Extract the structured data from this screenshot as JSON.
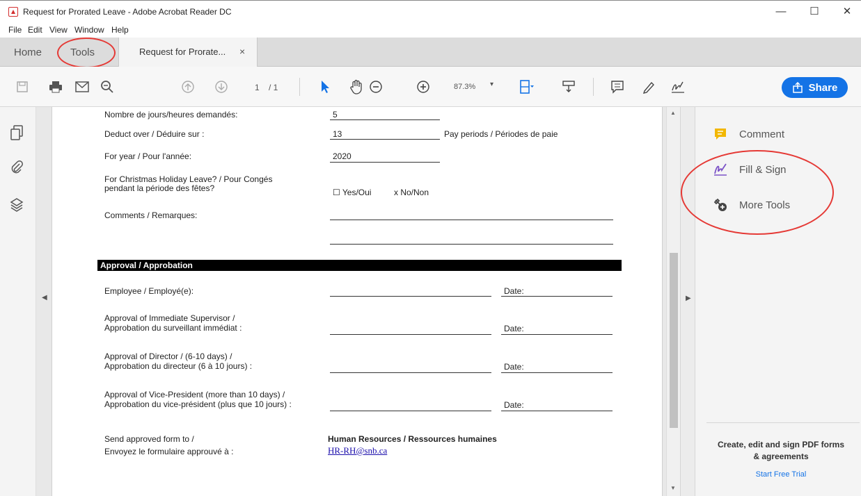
{
  "window": {
    "title": "Request for Prorated Leave - Adobe Acrobat Reader DC",
    "minimize": "—",
    "maximize": "☐",
    "close": "✕"
  },
  "menu": {
    "items": [
      "File",
      "Edit",
      "View",
      "Window",
      "Help"
    ]
  },
  "tabs": {
    "home": "Home",
    "tools": "Tools",
    "document": "Request for Prorate...",
    "close": "×"
  },
  "toolbar": {
    "page_current": "1",
    "page_total": "/ 1",
    "zoom": "87.3%",
    "share_label": "Share"
  },
  "right_panel": {
    "comment": "Comment",
    "fill_sign": "Fill & Sign",
    "more_tools": "More Tools",
    "promo_text": "Create, edit and sign PDF forms & agreements",
    "promo_link": "Start Free Trial"
  },
  "form": {
    "days_hours_label": "Nombre de jours/heures demandés:",
    "days_hours_value": "5",
    "deduct_label": "Deduct over / Déduire sur :",
    "deduct_value": "13",
    "deduct_unit": "Pay periods / Périodes de paie",
    "year_label": "For year / Pour l'année:",
    "year_value": "2020",
    "christmas_label_1": "For Christmas Holiday Leave? / Pour Congés",
    "christmas_label_2": "pendant la période des fêtes?",
    "yes_option": "☐ Yes/Oui",
    "no_option": "x No/Non",
    "comments_label": "Comments / Remarques:",
    "section_title": "Approval / Approbation",
    "employee_label": "Employee / Employé(e):",
    "supervisor_label_1": "Approval of Immediate Supervisor /",
    "supervisor_label_2": "Approbation du surveillant immédiat :",
    "director_label_1": "Approval of Director / (6-10 days) /",
    "director_label_2": "Approbation du directeur (6 à 10 jours) :",
    "vp_label_1": "Approval of Vice-President (more than 10 days) /",
    "vp_label_2": "Approbation du vice-président (plus que 10 jours) :",
    "date_label": "Date:",
    "send_label_1": "Send approved form to /",
    "send_label_2": "Envoyez le formulaire approuvé à :",
    "hr_department": "Human Resources / Ressources humaines",
    "hr_email": "HR-RH@snb.ca"
  }
}
